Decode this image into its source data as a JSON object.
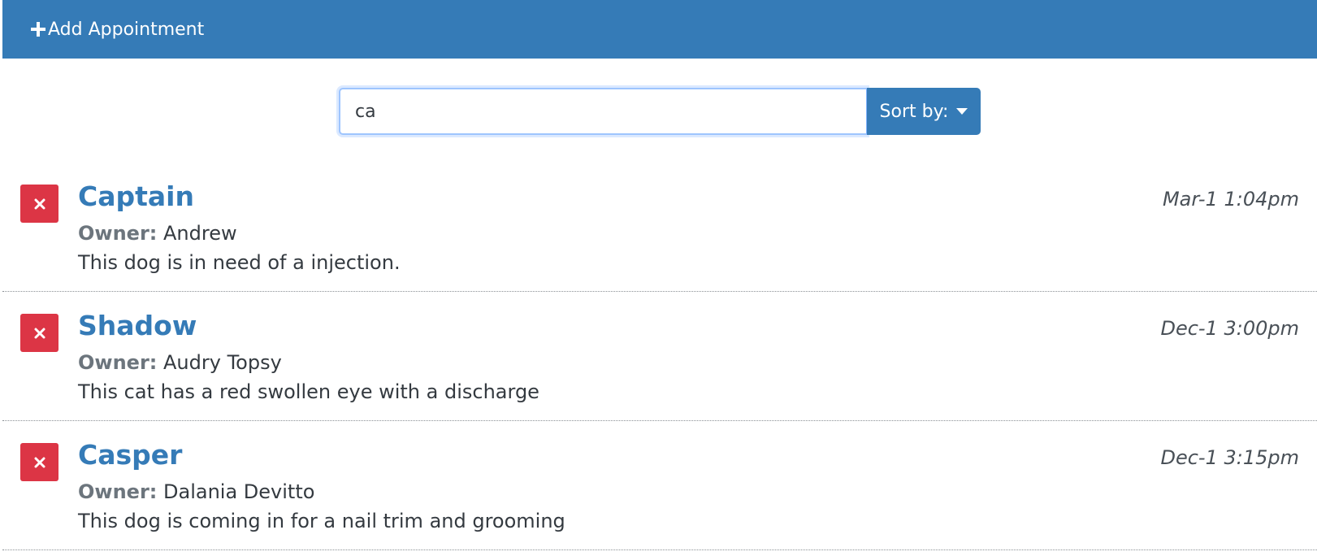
{
  "colors": {
    "primary": "#357bb7",
    "danger": "#dc3545"
  },
  "add_bar": {
    "icon": "plus-icon",
    "label": "Add Appointment"
  },
  "search": {
    "value": "ca",
    "sort_label": "Sort by:",
    "sort_icon": "caret-down-icon"
  },
  "appointments": [
    {
      "pet_name": "Captain",
      "owner_label": "Owner:",
      "owner": "Andrew",
      "notes": "This dog is in need of a injection.",
      "date": "Mar-1 1:04pm",
      "delete_icon": "times-icon"
    },
    {
      "pet_name": "Shadow",
      "owner_label": "Owner:",
      "owner": "Audry Topsy",
      "notes": "This cat has a red swollen eye with a discharge",
      "date": "Dec-1 3:00pm",
      "delete_icon": "times-icon"
    },
    {
      "pet_name": "Casper",
      "owner_label": "Owner:",
      "owner": "Dalania Devitto",
      "notes": "This dog is coming in for a nail trim and grooming",
      "date": "Dec-1 3:15pm",
      "delete_icon": "times-icon"
    }
  ]
}
